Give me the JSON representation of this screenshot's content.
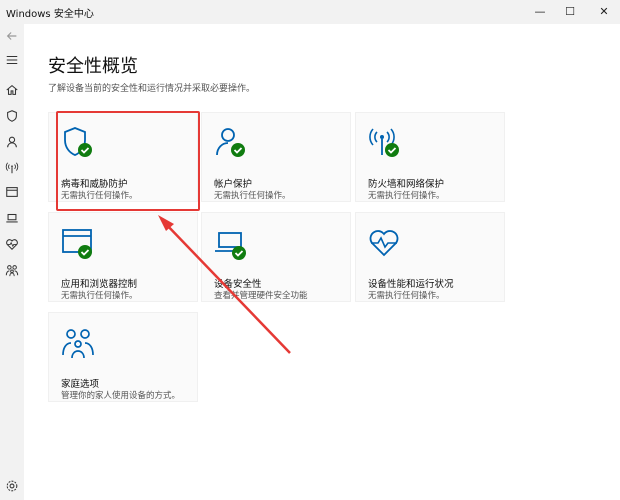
{
  "window": {
    "title": "Windows 安全中心",
    "minimize_icon": "—",
    "maximize_icon": "☐",
    "close_icon": "✕"
  },
  "sidebar": {
    "items": [
      {
        "icon": "back-arrow-icon"
      },
      {
        "icon": "hamburger-menu-icon"
      },
      {
        "icon": "home-icon"
      },
      {
        "icon": "shield-icon"
      },
      {
        "icon": "person-icon"
      },
      {
        "icon": "wifi-signal-icon"
      },
      {
        "icon": "browser-window-icon"
      },
      {
        "icon": "laptop-icon"
      },
      {
        "icon": "heart-pulse-icon"
      },
      {
        "icon": "family-icon"
      },
      {
        "icon": "gear-icon"
      }
    ]
  },
  "main": {
    "title": "安全性概览",
    "subtitle": "了解设备当前的安全性和运行情况并采取必要操作。",
    "tiles": [
      {
        "name": "病毒和威胁防护",
        "status": "无需执行任何操作。",
        "icon": "shield-check-icon"
      },
      {
        "name": "帐户保护",
        "status": "无需执行任何操作。",
        "icon": "person-check-icon"
      },
      {
        "name": "防火墙和网络保护",
        "status": "无需执行任何操作。",
        "icon": "antenna-check-icon"
      },
      {
        "name": "应用和浏览器控制",
        "status": "无需执行任何操作。",
        "icon": "browser-check-icon"
      },
      {
        "name": "设备安全性",
        "status": "查看并管理硬件安全功能",
        "icon": "laptop-check-icon"
      },
      {
        "name": "设备性能和运行状况",
        "status": "无需执行任何操作。",
        "icon": "heart-pulse-icon"
      },
      {
        "name": "家庭选项",
        "status": "管理你的家人使用设备的方式。",
        "icon": "family-icon"
      }
    ]
  },
  "colors": {
    "accent": "#0063b1",
    "check": "#107c10",
    "annotation": "#e53935"
  }
}
